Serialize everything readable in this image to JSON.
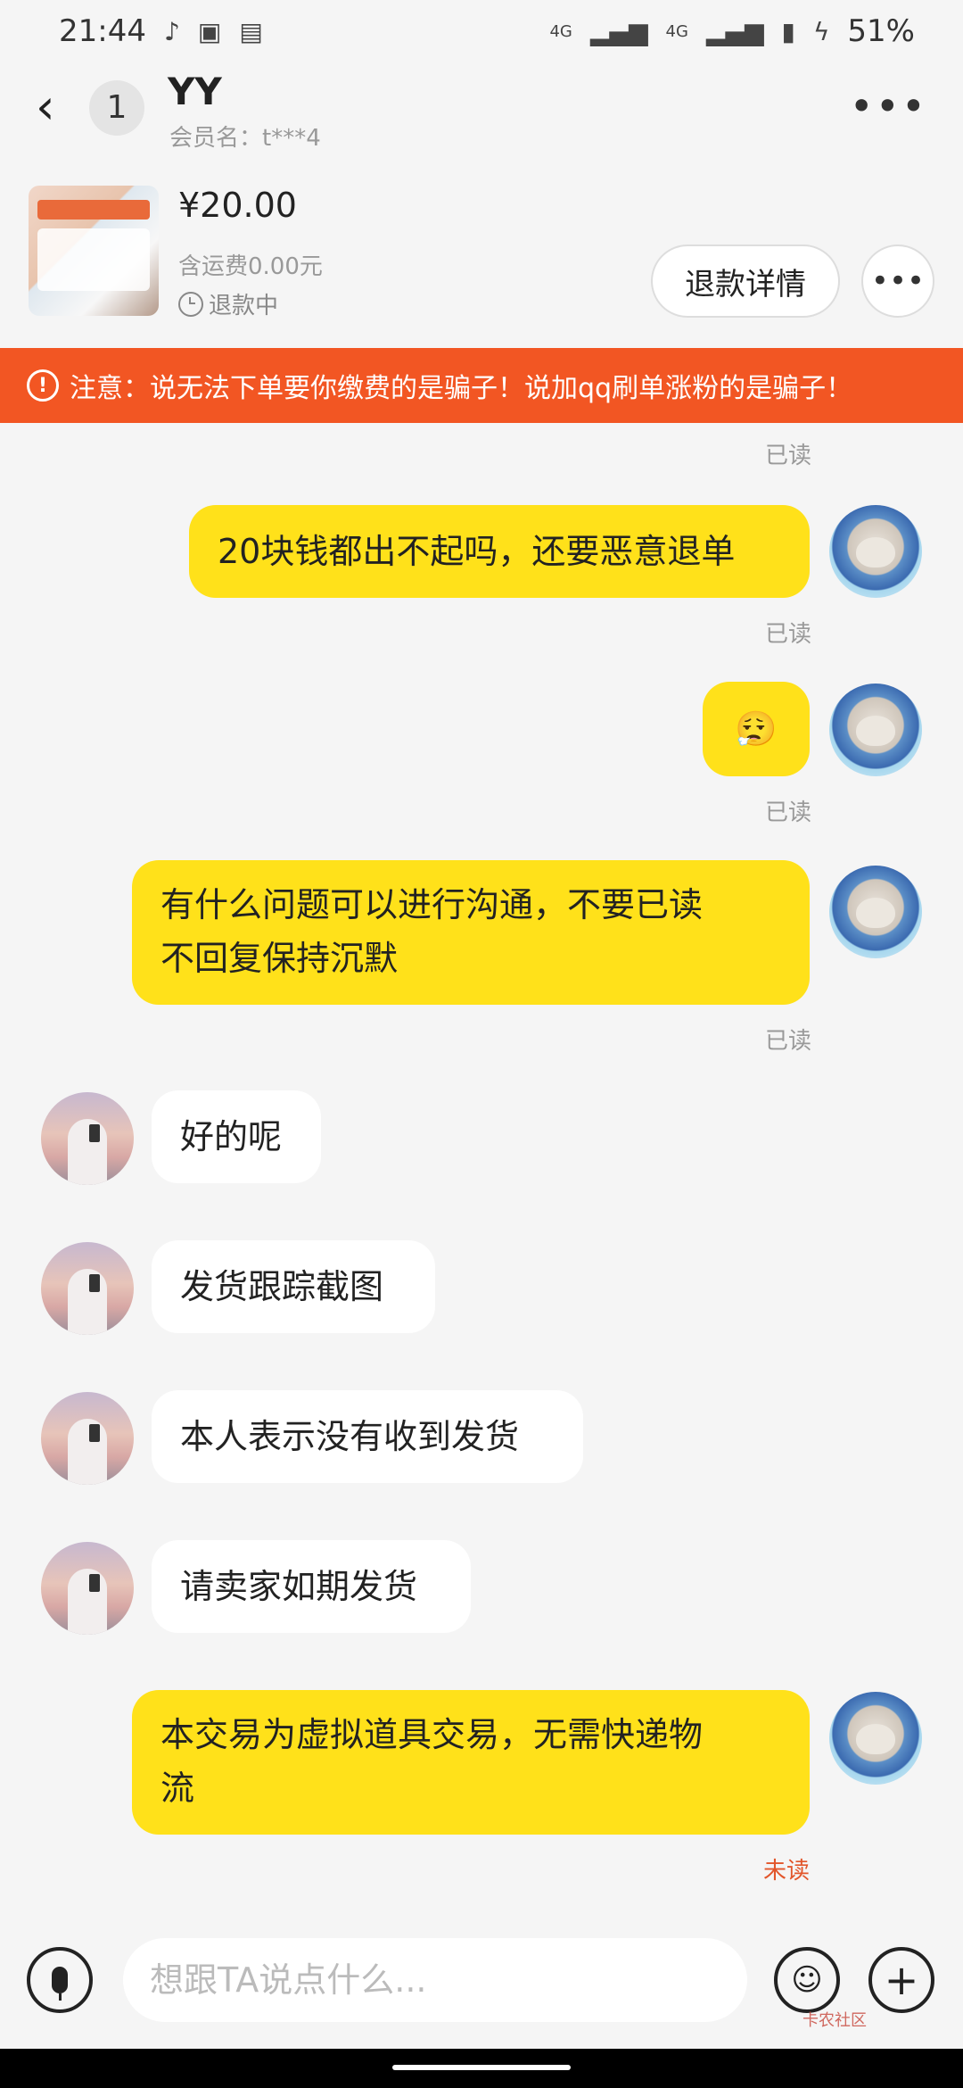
{
  "status_bar": {
    "time": "21:44",
    "network1": "4G",
    "network2": "4G",
    "battery": "51%"
  },
  "header": {
    "back_icon": "‹",
    "unread_count": "1",
    "contact_name": "YY",
    "member_label": "会员名：t***4"
  },
  "order": {
    "price": "¥20.00",
    "shipping": "含运费0.00元",
    "refund_status": "退款中",
    "refund_detail_label": "退款详情",
    "more_label": "•••"
  },
  "warning": {
    "text": "注意：说无法下单要你缴费的是骗子！说加qq刷单涨粉的是骗子！"
  },
  "messages": [
    {
      "read_top": "已读"
    },
    {
      "text": "20块钱都出不起吗，还要恶意退单",
      "status": "已读"
    },
    {
      "emoji": "😮‍💨",
      "status": "已读"
    },
    {
      "line1": "有什么问题可以进行沟通，不要已读",
      "line2": "不回复保持沉默",
      "status": "已读"
    },
    {
      "text": "好的呢"
    },
    {
      "text": "发货跟踪截图"
    },
    {
      "text": "本人表示没有收到发货"
    },
    {
      "text": "请卖家如期发货"
    },
    {
      "line1": "本交易为虚拟道具交易，无需快递物",
      "line2": "流",
      "status": "未读"
    }
  ],
  "input": {
    "placeholder": "想跟TA说点什么..."
  },
  "watermark": "卡农社区"
}
